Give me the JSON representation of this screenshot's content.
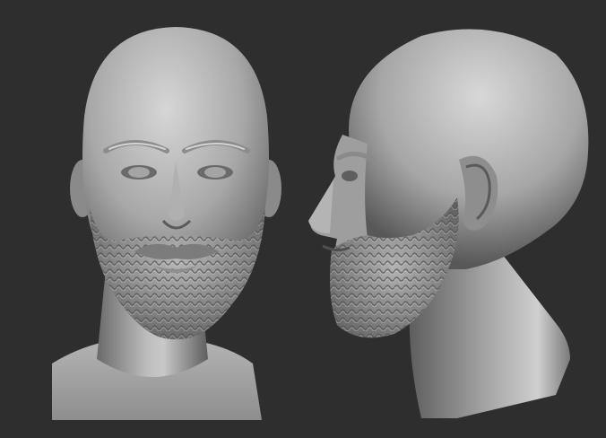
{
  "scene": {
    "background_color": "#2e2e2e",
    "clay_highlight": "#d2d2d2",
    "clay_mid": "#9a9a9a",
    "clay_shadow": "#4a4a4a",
    "subject": "sculpted-male-head-with-beard",
    "views": [
      {
        "view": "front"
      },
      {
        "view": "profile-left"
      }
    ]
  }
}
